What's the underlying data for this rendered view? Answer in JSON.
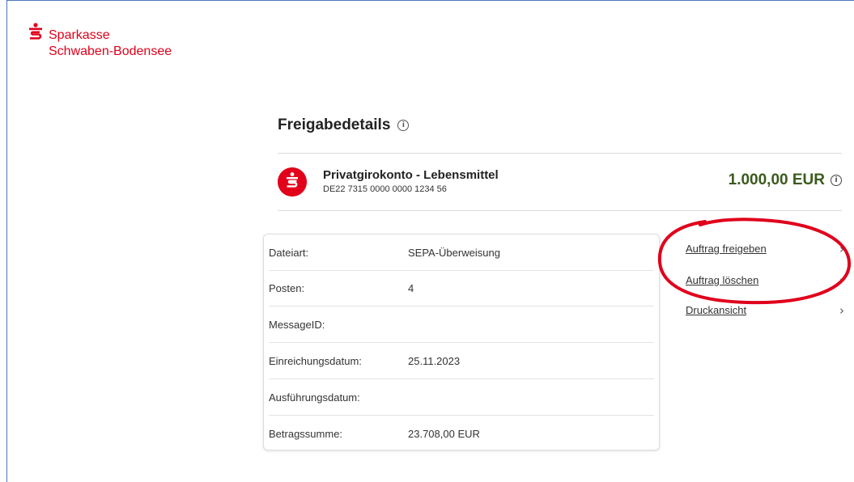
{
  "bank": {
    "line1": "Sparkasse",
    "line2": "Schwaben-Bodensee"
  },
  "page": {
    "title": "Freigabedetails",
    "info_symbol": "i"
  },
  "account": {
    "name": "Privatgirokonto - Lebensmittel",
    "iban": "DE22 7315 0000 0000 1234 56",
    "amount": "1.000,00 EUR",
    "amount_color": "#3b5a1e"
  },
  "details": [
    {
      "label": "Dateiart:",
      "value": "SEPA-Überweisung"
    },
    {
      "label": "Posten:",
      "value": "4"
    },
    {
      "label": "MessageID:",
      "value": ""
    },
    {
      "label": "Einreichungsdatum:",
      "value": "25.11.2023"
    },
    {
      "label": "Ausführungsdatum:",
      "value": ""
    },
    {
      "label": "Betragssumme:",
      "value": "23.708,00 EUR"
    }
  ],
  "actions": [
    {
      "label": "Auftrag freigeben",
      "icon": "chevron-right-icon"
    },
    {
      "label": "Auftrag löschen",
      "icon": "chevron-right-icon"
    },
    {
      "label": "Druckansicht",
      "icon": "chevron-right-icon"
    }
  ],
  "colors": {
    "brand": "#e2001a",
    "annotation": "#e0001b"
  }
}
